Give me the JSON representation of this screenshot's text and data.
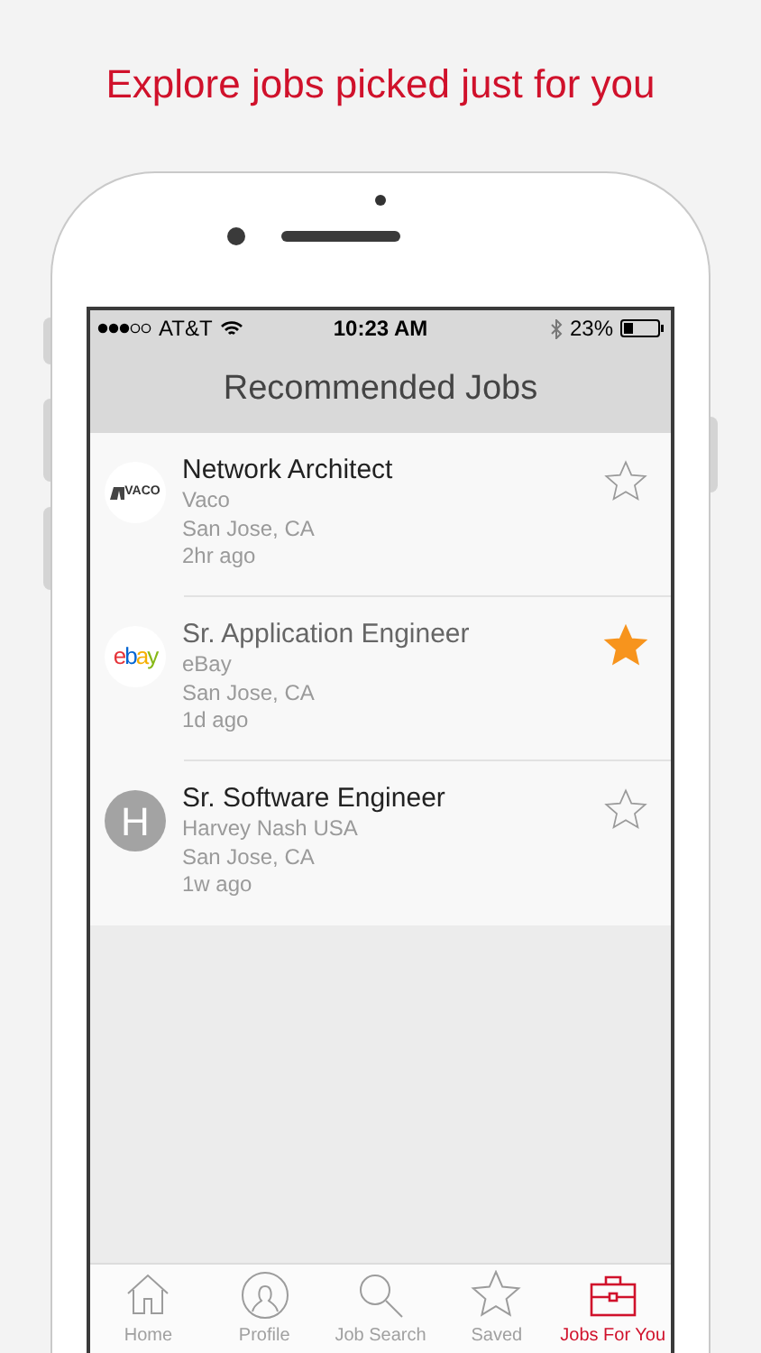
{
  "headline": "Explore jobs picked just for you",
  "status_bar": {
    "carrier": "AT&T",
    "time": "10:23 AM",
    "battery": "23%"
  },
  "header": {
    "title": "Recommended Jobs"
  },
  "jobs": [
    {
      "logo": {
        "kind": "vaco",
        "text": "VACO"
      },
      "title": "Network Architect",
      "company": "Vaco",
      "location": "San Jose, CA",
      "posted": "2hr ago",
      "saved": false
    },
    {
      "logo": {
        "kind": "ebay",
        "text": "ebay"
      },
      "title": "Sr. Application Engineer",
      "company": "eBay",
      "location": "San Jose, CA",
      "posted": "1d ago",
      "saved": true
    },
    {
      "logo": {
        "kind": "letter",
        "text": "H"
      },
      "title": "Sr. Software Engineer",
      "company": "Harvey Nash USA",
      "location": "San Jose, CA",
      "posted": "1w ago",
      "saved": false
    }
  ],
  "tab_bar": [
    {
      "label": "Home",
      "kind": "home",
      "selected": false
    },
    {
      "label": "Profile",
      "kind": "profile",
      "selected": false
    },
    {
      "label": "Job Search",
      "kind": "search",
      "selected": false
    },
    {
      "label": "Saved",
      "kind": "star",
      "selected": false
    },
    {
      "label": "Jobs For You",
      "kind": "briefcase",
      "selected": true
    }
  ]
}
